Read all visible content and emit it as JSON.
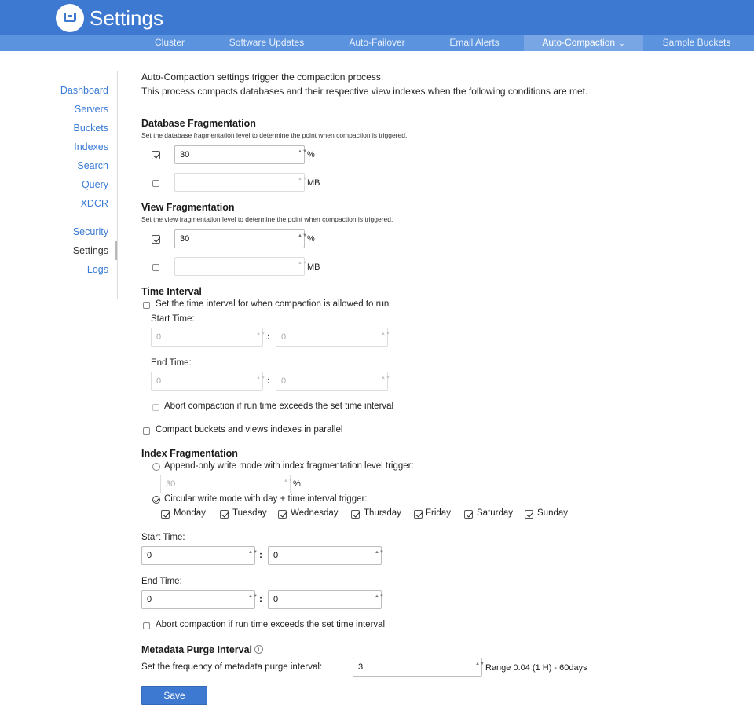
{
  "header": {
    "app_title": "Settings",
    "logo_icon": "couchbase-logo"
  },
  "subnav": {
    "tabs": [
      {
        "label": "Cluster"
      },
      {
        "label": "Software Updates"
      },
      {
        "label": "Auto-Failover"
      },
      {
        "label": "Email Alerts"
      },
      {
        "label": "Auto-Compaction",
        "active": true
      },
      {
        "label": "Sample Buckets"
      }
    ],
    "chevron": "⌄"
  },
  "sidebar": {
    "items": [
      "Dashboard",
      "Servers",
      "Buckets",
      "Indexes",
      "Search",
      "Query",
      "XDCR",
      "Security",
      "Settings",
      "Logs"
    ],
    "active": "Settings"
  },
  "intro": {
    "line1": "Auto-Compaction settings trigger the compaction process.",
    "line2": "This process compacts databases and their respective view indexes when the following conditions are met."
  },
  "db_frag": {
    "title": "Database Fragmentation",
    "desc": "Set the database fragmentation level to determine the point when compaction is triggered.",
    "percent_value": "30",
    "percent_unit": "%",
    "percent_checked": true,
    "mb_value": "",
    "mb_unit": "MB",
    "mb_checked": false
  },
  "view_frag": {
    "title": "View Fragmentation",
    "desc": "Set the view fragmentation level to determine the point when compaction is triggered.",
    "percent_value": "30",
    "percent_unit": "%",
    "percent_checked": true,
    "mb_value": "",
    "mb_unit": "MB",
    "mb_checked": false
  },
  "time_interval": {
    "title": "Time Interval",
    "enable_label": "Set the time interval for when compaction is allowed to run",
    "start_label": "Start Time:",
    "start_hour": "0",
    "start_min": "0",
    "end_label": "End Time:",
    "end_hour": "0",
    "end_min": "0",
    "abort_label": "Abort compaction if run time exceeds the set time interval"
  },
  "parallel_label": "Compact buckets and views indexes in parallel",
  "index_frag": {
    "title": "Index Fragmentation",
    "append_label": "Append-only write mode with index fragmentation level trigger:",
    "append_value": "30",
    "append_unit": "%",
    "circular_label": "Circular write mode with day + time interval trigger:",
    "days": [
      "Monday",
      "Tuesday",
      "Wednesday",
      "Thursday",
      "Friday",
      "Saturday",
      "Sunday"
    ],
    "start_label": "Start Time:",
    "start_hour": "0",
    "start_min": "0",
    "end_label": "End Time:",
    "end_hour": "0",
    "end_min": "0",
    "abort_label": "Abort compaction if run time exceeds the set time interval"
  },
  "metadata": {
    "title": "Metadata Purge Interval",
    "label": "Set the frequency of metadata purge interval:",
    "value": "3",
    "range": "Range 0.04 (1 H) - 60days"
  },
  "save_label": "Save",
  "colon": ":",
  "spinner": "▲▼"
}
